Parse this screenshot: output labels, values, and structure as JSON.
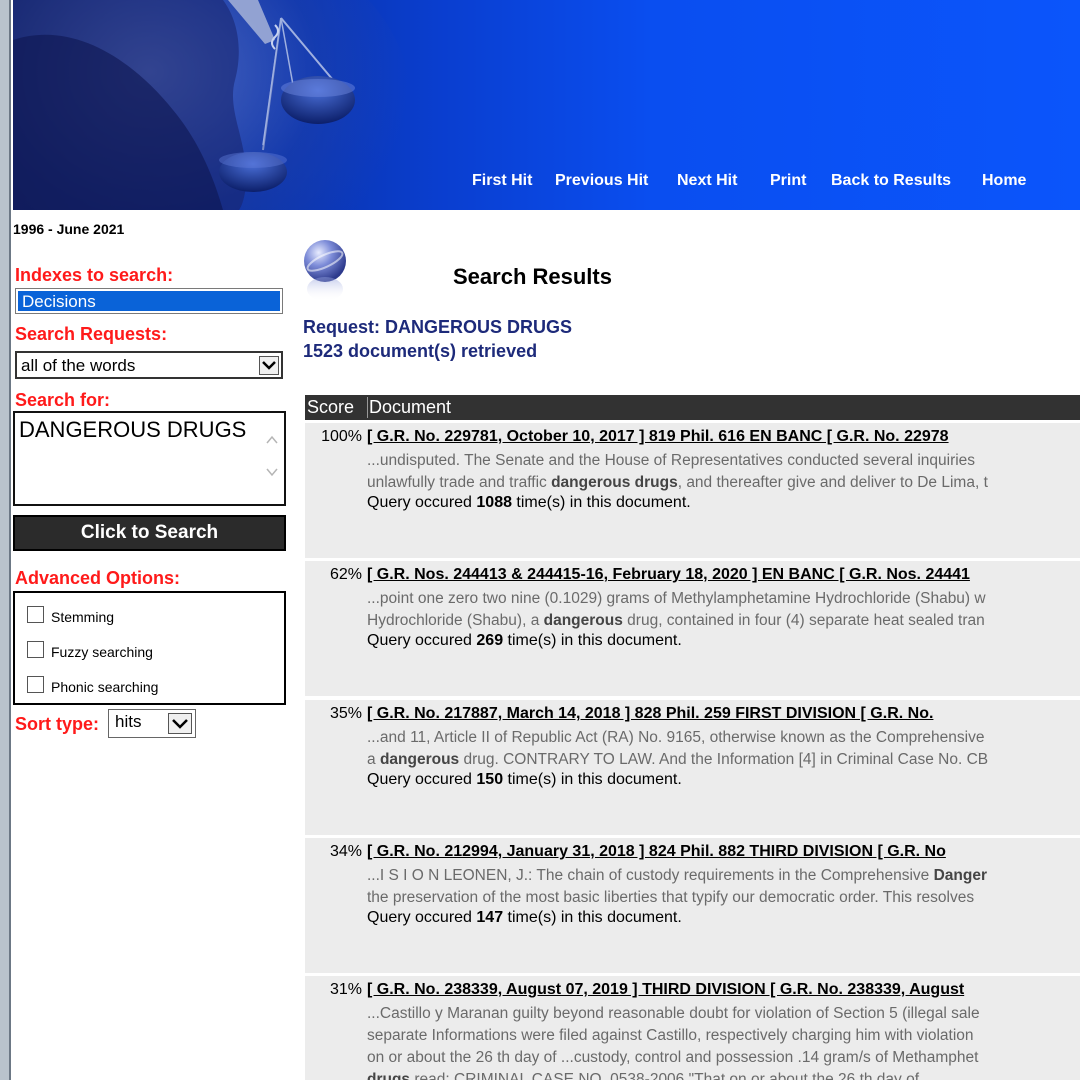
{
  "nav": {
    "first_hit": "First Hit",
    "previous_hit": "Previous Hit",
    "next_hit": "Next Hit",
    "print": "Print",
    "back_to_results": "Back to Results",
    "home": "Home"
  },
  "sidebar": {
    "years": "1996 - June 2021",
    "indexes_label": "Indexes to search:",
    "index_selected": "Decisions",
    "search_requests_label": "Search Requests:",
    "search_request_value": "all of the words",
    "search_for_label": "Search for:",
    "search_for_value": "DANGEROUS DRUGS",
    "search_button": "Click to Search",
    "advanced_label": "Advanced Options:",
    "options": [
      "Stemming",
      "Fuzzy searching",
      "Phonic searching"
    ],
    "sort_label": "Sort type:",
    "sort_value": "hits"
  },
  "main": {
    "title": "Search Results",
    "request": "Request: DANGEROUS DRUGS",
    "retrieved": "1523 document(s) retrieved",
    "col_score": "Score",
    "col_document": "Document",
    "results": [
      {
        "score": "100%",
        "title": "[ G.R. No. 229781, October 10, 2017 ] 819 Phil. 616 EN BANC [ G.R. No. 22978",
        "snippet": [
          [
            {
              "t": "...undisputed. The Senate and the House of Representatives conducted several inquiries"
            }
          ],
          [
            {
              "t": "unlawfully trade and traffic "
            },
            {
              "t": "dangerous drugs",
              "b": true
            },
            {
              "t": ", and thereafter give and deliver to De Lima, t"
            }
          ]
        ],
        "occ_pre": "Query occured ",
        "occ_count": "1088",
        "occ_post": " time(s) in this document."
      },
      {
        "score": "62%",
        "title": "[ G.R. Nos. 244413 & 244415-16, February 18, 2020 ] EN BANC [ G.R. Nos. 24441",
        "snippet": [
          [
            {
              "t": "...point one zero two nine (0.1029) grams of Methylamphetamine Hydrochloride (Shabu) w"
            }
          ],
          [
            {
              "t": "Hydrochloride (Shabu), a "
            },
            {
              "t": "dangerous",
              "b": true
            },
            {
              "t": " drug, contained in four (4) separate heat sealed tran"
            }
          ]
        ],
        "occ_pre": "Query occured ",
        "occ_count": "269",
        "occ_post": " time(s) in this document."
      },
      {
        "score": "35%",
        "title": "[ G.R. No. 217887, March 14, 2018 ] 828 Phil. 259 FIRST DIVISION [ G.R. No.",
        "snippet": [
          [
            {
              "t": "...and 11, Article II of Republic Act (RA) No. 9165, otherwise known as the Comprehensive"
            }
          ],
          [
            {
              "t": "a "
            },
            {
              "t": "dangerous",
              "b": true
            },
            {
              "t": " drug. CONTRARY TO LAW. And the Information [4] in Criminal Case No. CB"
            }
          ]
        ],
        "occ_pre": "Query occured ",
        "occ_count": "150",
        "occ_post": " time(s) in this document."
      },
      {
        "score": "34%",
        "title": "[ G.R. No. 212994, January 31, 2018 ] 824 Phil. 882 THIRD DIVISION [ G.R. No",
        "snippet": [
          [
            {
              "t": "...I S I O N LEONEN, J.: The chain of custody requirements in the Comprehensive "
            },
            {
              "t": "Danger",
              "b": true
            }
          ],
          [
            {
              "t": "the preservation of the most basic liberties that typify our democratic order. This resolves"
            }
          ]
        ],
        "occ_pre": "Query occured ",
        "occ_count": "147",
        "occ_post": " time(s) in this document."
      },
      {
        "score": "31%",
        "title": "[ G.R. No. 238339, August 07, 2019 ] THIRD DIVISION [ G.R. No. 238339, August",
        "snippet": [
          [
            {
              "t": "...Castillo y Maranan guilty beyond reasonable doubt for violation of Section 5 (illegal sale"
            }
          ],
          [
            {
              "t": "separate Informations were filed against Castillo, respectively charging him with violation"
            }
          ],
          [
            {
              "t": "on or about the 26 th day of ...custody, control and possession .14 gram/s of Methamphet"
            }
          ],
          [
            {
              "t": "drugs",
              "b": true
            },
            {
              "t": " read: CRIMINAL CASE NO. 0538-2006 \"That on or about the 26 th day of"
            }
          ]
        ]
      }
    ]
  }
}
